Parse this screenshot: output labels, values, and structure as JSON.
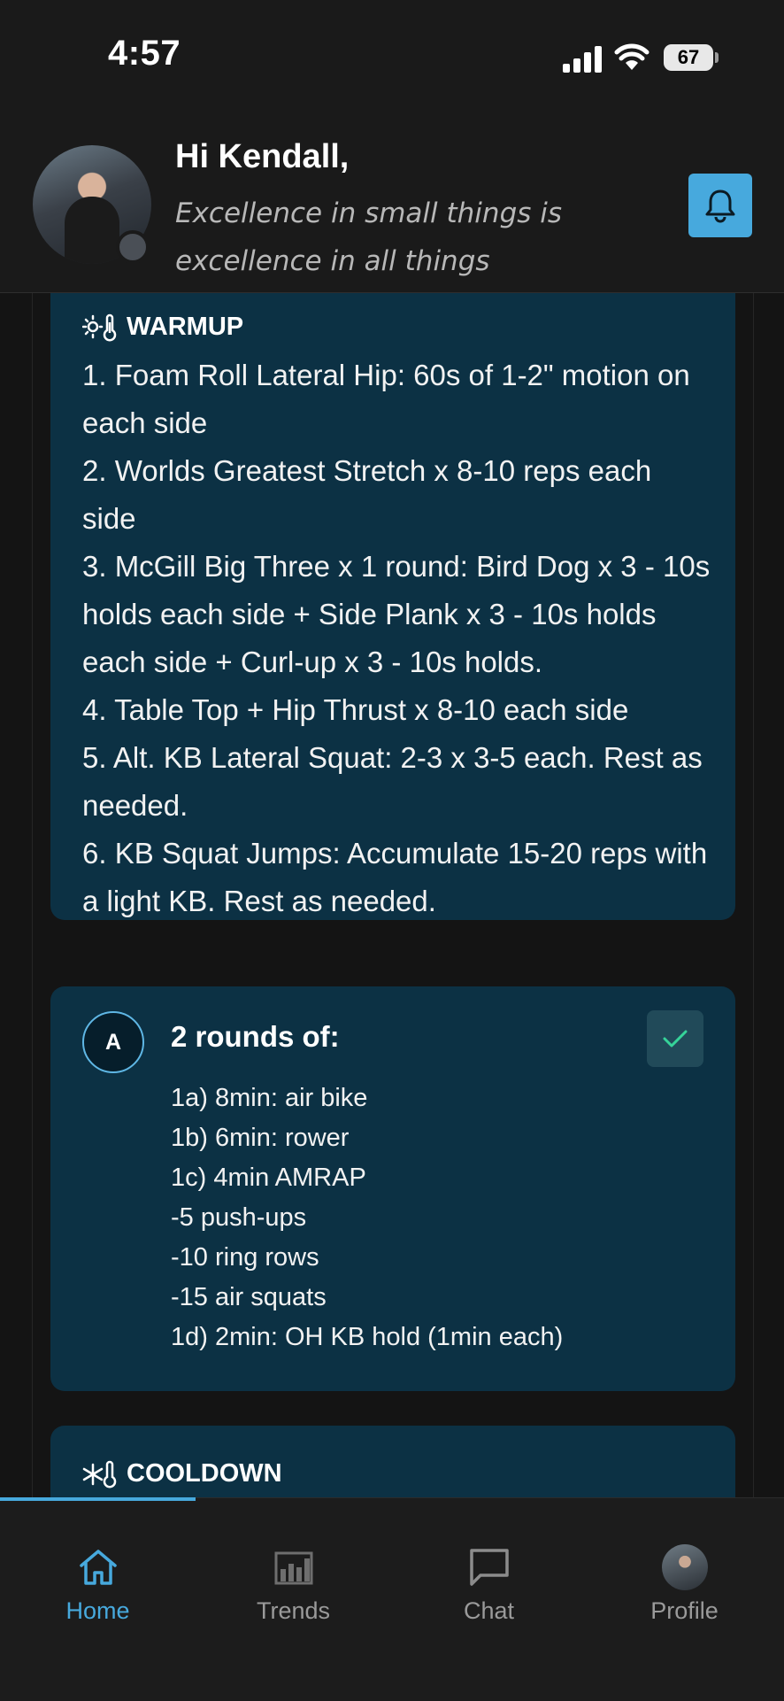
{
  "status_bar": {
    "time": "4:57",
    "battery": "67"
  },
  "header": {
    "greeting": "Hi Kendall,",
    "quote": "Excellence in small things is excellence in all things"
  },
  "warmup": {
    "title": "WARMUP",
    "text": "1. Foam Roll Lateral Hip: 60s of 1-2\" motion on each side\n2. Worlds Greatest Stretch x 8-10 reps each side\n3. McGill Big Three x 1 round: Bird Dog x 3 - 10s holds each side + Side Plank x 3 - 10s holds each side + Curl-up x 3 - 10s holds.\n4. Table Top + Hip Thrust x 8-10 each side\n5. Alt. KB Lateral Squat: 2-3 x 3-5 each. Rest as needed.\n6. KB Squat Jumps: Accumulate 15-20 reps with a light KB. Rest as needed."
  },
  "block_a": {
    "badge": "A",
    "title": "2 rounds of:",
    "text": "1a) 8min: air bike\n1b) 6min: rower\n1c) 4min AMRAP\n-5 push-ups\n-10 ring rows\n-15 air squats\n1d) 2min: OH KB hold (1min each)",
    "completed": true
  },
  "cooldown": {
    "title": "COOLDOWN"
  },
  "tabs": [
    {
      "label": "Home",
      "icon": "home-icon",
      "active": true
    },
    {
      "label": "Trends",
      "icon": "bar-chart-icon",
      "active": false
    },
    {
      "label": "Chat",
      "icon": "chat-icon",
      "active": false
    },
    {
      "label": "Profile",
      "icon": "profile-avatar",
      "active": false
    }
  ],
  "colors": {
    "accent": "#47a9dd",
    "card": "#0c3144",
    "background": "#141414",
    "check": "#36d399"
  }
}
